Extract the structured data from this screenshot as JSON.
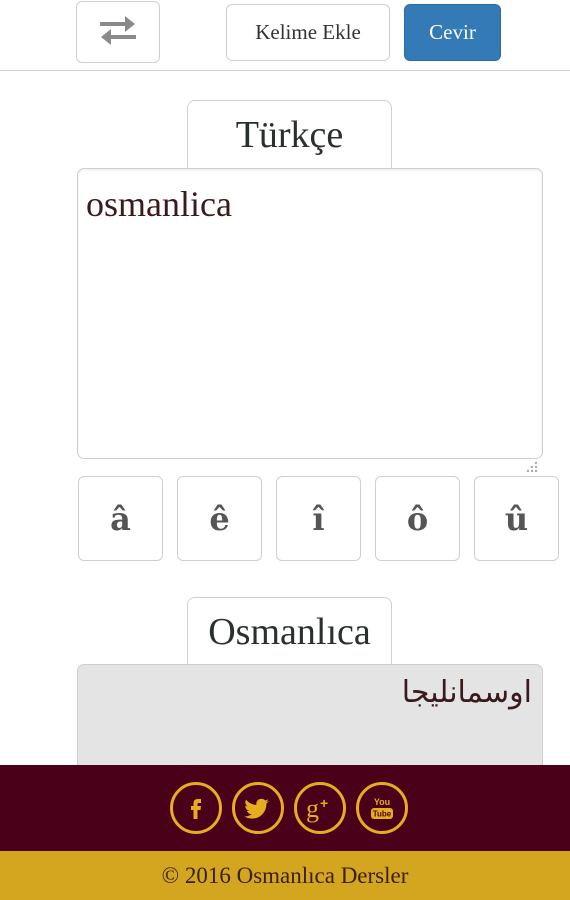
{
  "toolbar": {
    "swap_icon": "swap-arrows-icon",
    "add_word_label": "Kelime Ekle",
    "translate_label": "Cevir"
  },
  "source": {
    "tab_label": "Türkçe",
    "input_value": "osmanlica"
  },
  "special_chars": [
    "â",
    "ê",
    "î",
    "ô",
    "û"
  ],
  "target": {
    "tab_label": "Osmanlıca",
    "output_value": "اوسمانليجا"
  },
  "footer": {
    "social": [
      {
        "icon": "facebook-icon",
        "glyph": "f"
      },
      {
        "icon": "twitter-icon",
        "glyph": "bird"
      },
      {
        "icon": "google-plus-icon",
        "glyph": "g+"
      },
      {
        "icon": "youtube-icon",
        "glyph": "YouTube"
      }
    ],
    "copyright": "© 2016 Osmanlıca Dersler"
  },
  "colors": {
    "primary_button": "#337ab7",
    "footer_dark": "#4a0018",
    "footer_gold": "#d4a51f",
    "social_icon": "#e6ad1f",
    "output_bg": "#e4e4e4"
  }
}
